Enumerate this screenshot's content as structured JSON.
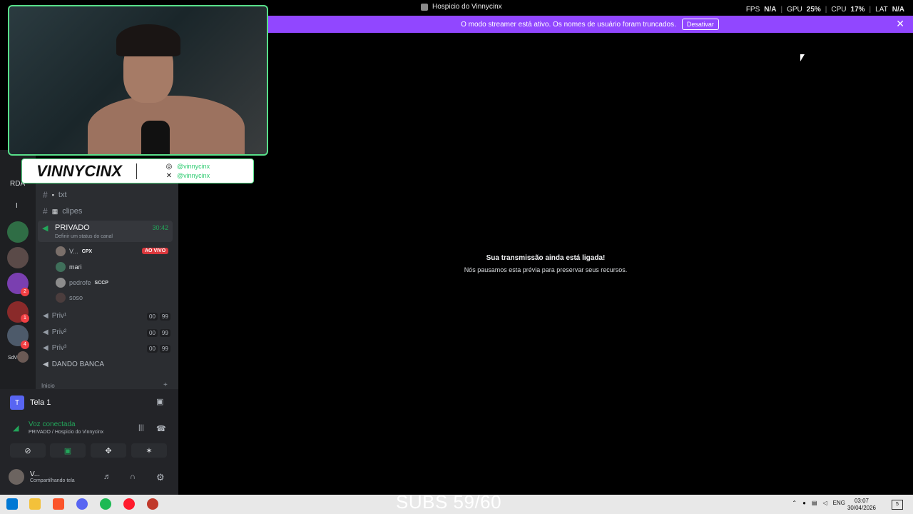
{
  "title_bar": {
    "window_title": "Hospicio do Vinnycinx",
    "stats": [
      {
        "label": "FPS",
        "value": "N/A"
      },
      {
        "label": "GPU",
        "value": "25%"
      },
      {
        "label": "CPU",
        "value": "17%"
      },
      {
        "label": "LAT",
        "value": "N/A"
      }
    ]
  },
  "streamer_banner": {
    "message": "O modo streamer está ativo. Os nomes de usuário foram truncados.",
    "button": "Desativar",
    "close_glyph": "✕",
    "color": "#9147ff"
  },
  "rail": {
    "label_rda": "RDA",
    "label_i": "I",
    "label_sdv": "SdV",
    "badges": [
      "2",
      "1",
      "4"
    ]
  },
  "channels": {
    "text": [
      {
        "name": "txt",
        "icon": "chat-icon"
      },
      {
        "name": "clipes",
        "icon": "clapper-icon"
      }
    ],
    "active_voice": {
      "name": "PRIVADO",
      "time": "30:42",
      "status_hint": "Definir um status do canal"
    },
    "members": [
      {
        "name": "V...",
        "tag": "CPX",
        "live": "AO VIVO"
      },
      {
        "name": "mari",
        "tag": "",
        "live": ""
      },
      {
        "name": "pedrofe",
        "tag": "SCCP",
        "live": ""
      },
      {
        "name": "soso",
        "tag": "",
        "live": ""
      }
    ],
    "private_rooms": [
      {
        "name": "Priv¹",
        "c1": "00",
        "c2": "99"
      },
      {
        "name": "Priv²",
        "c1": "00",
        "c2": "99"
      },
      {
        "name": "Priv³",
        "c1": "00",
        "c2": "99"
      }
    ],
    "dando_banca": "DANDO BANCA",
    "section_label": "Inicio",
    "section_add": "+"
  },
  "bottom_panel": {
    "screen": {
      "icon_letter": "T",
      "label": "Tela 1"
    },
    "voice_status": "Voz conectada",
    "voice_channel": "PRIVADO / Hospicio do Vinnycinx",
    "user_name": "V...",
    "user_status": "Compartilhando tela"
  },
  "overlay": {
    "name": "VINNYCINX",
    "instagram": "@vinnycinx",
    "x_handle": "@vinnycinx",
    "accent": "#58e08a"
  },
  "stage": {
    "title": "Sua transmissão ainda está ligada!",
    "subtitle": "Nós pausamos esta prévia para preservar seus recursos."
  },
  "taskbar": {
    "subs_text": "SUBS 59/60",
    "lang": "ENG",
    "time": "03:07",
    "date": "30/04/2026",
    "notif_count": "5"
  }
}
